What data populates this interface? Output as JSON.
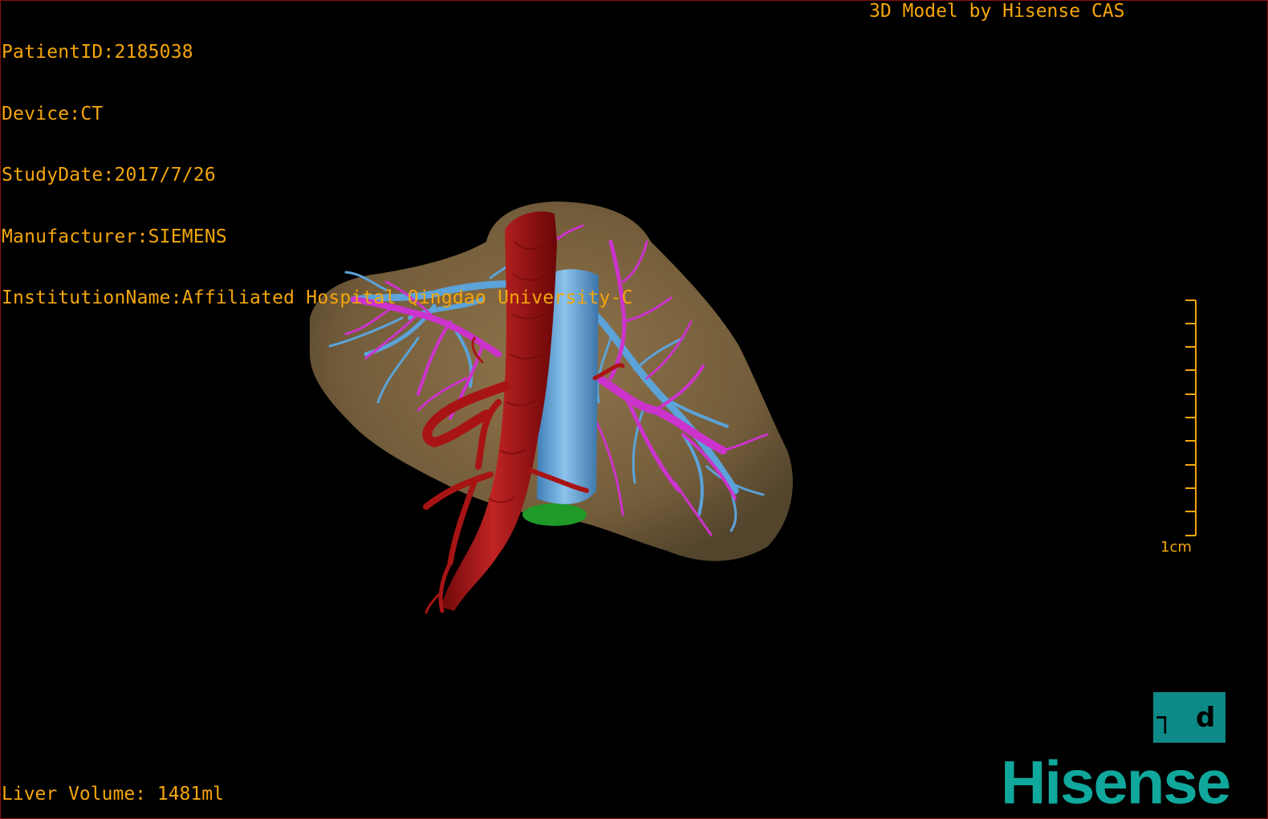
{
  "header": {
    "patient_id": "PatientID:2185038",
    "device": "Device:CT",
    "study_date": "StudyDate:2017/7/26",
    "manufacturer": "Manufacturer:SIEMENS",
    "institution": "InstitutionName:Affiliated Hospital Qingdao University-C"
  },
  "credit": "3D Model by Hisense CAS",
  "footer": {
    "liver_volume": "Liver Volume: 1481ml"
  },
  "scale": {
    "label": "1cm"
  },
  "orientation": {
    "label": "┐ d",
    "icon": "orientation-cube-icon"
  },
  "brand": {
    "logo_text": "Hisense",
    "color": "#10a89c"
  },
  "colors": {
    "text": "#f4a60a",
    "liver": "#8a6f45",
    "artery": "#a81414",
    "portal_vein": "#cc33cc",
    "hepatic_vein": "#5ba3d9",
    "gallbladder": "#1f9a28",
    "border": "#8a1010"
  }
}
